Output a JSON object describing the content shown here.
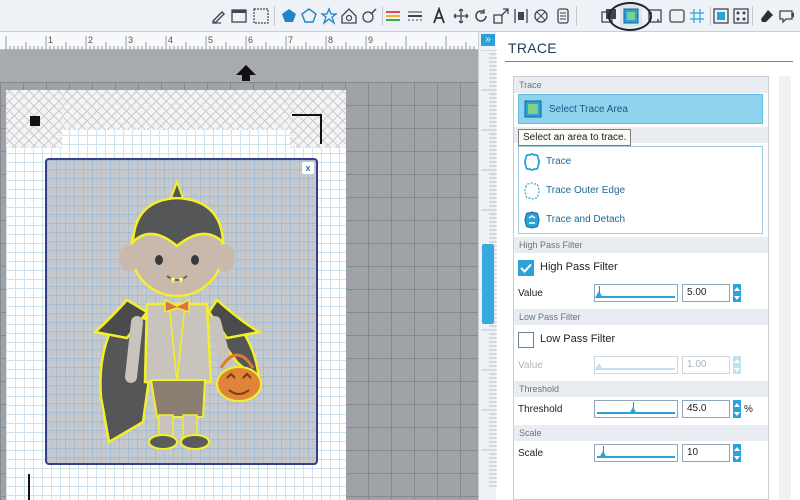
{
  "toolbar": {
    "tools": [
      {
        "icon": "pen-draw-icon"
      },
      {
        "icon": "window-icon"
      },
      {
        "icon": "grid-dots-icon"
      },
      {
        "icon": "pentagon-filled-icon"
      },
      {
        "icon": "polygon-outline-icon"
      },
      {
        "icon": "star-outline-icon"
      },
      {
        "icon": "shape-library-icon"
      },
      {
        "icon": "pen-circle-icon"
      },
      {
        "icon": "line-color-icon"
      },
      {
        "icon": "line-style-icon"
      },
      {
        "icon": "text-icon"
      },
      {
        "icon": "transform-move-icon"
      },
      {
        "icon": "rotate-icon"
      },
      {
        "icon": "scale-icon"
      },
      {
        "icon": "align-icon"
      },
      {
        "icon": "replicate-icon"
      },
      {
        "icon": "modify-icon"
      },
      {
        "icon": "offset-icon"
      },
      {
        "icon": "trace-icon",
        "active": true
      },
      {
        "icon": "page-setup-icon"
      },
      {
        "icon": "grid-settings-icon"
      },
      {
        "icon": "registration-icon"
      },
      {
        "icon": "library-icon"
      },
      {
        "icon": "eraser-icon"
      },
      {
        "icon": "send-icon"
      }
    ]
  },
  "ruler": {
    "ticks": [
      "1",
      "2",
      "3",
      "4",
      "5",
      "6",
      "7",
      "8",
      "9"
    ]
  },
  "panel": {
    "title": "TRACE",
    "trace_section": {
      "header": "Trace",
      "select_button": "Select Trace Area",
      "tooltip": "Select an area to trace.",
      "options": [
        "Trace",
        "Trace Outer Edge",
        "Trace and Detach"
      ]
    },
    "high_pass": {
      "header": "High Pass Filter",
      "checkbox_label": "High Pass Filter",
      "checked": true,
      "value_label": "Value",
      "value": "5.00",
      "slider_level": 0.02
    },
    "low_pass": {
      "header": "Low Pass Filter",
      "checkbox_label": "Low Pass Filter",
      "checked": false,
      "value_label": "Value",
      "value": "1.00",
      "slider_level": 0.02
    },
    "threshold": {
      "header": "Threshold",
      "label": "Threshold",
      "value": "45.0",
      "unit": "%",
      "slider_level": 0.45
    },
    "scale": {
      "header": "Scale",
      "label": "Scale",
      "value": "10",
      "slider_level": 0.08
    }
  },
  "colors": {
    "accent": "#2ba3da",
    "selected_button": "#8fd3ee",
    "trace_outline": "#f3f02a",
    "trace_frame": "#3a3d8f"
  }
}
